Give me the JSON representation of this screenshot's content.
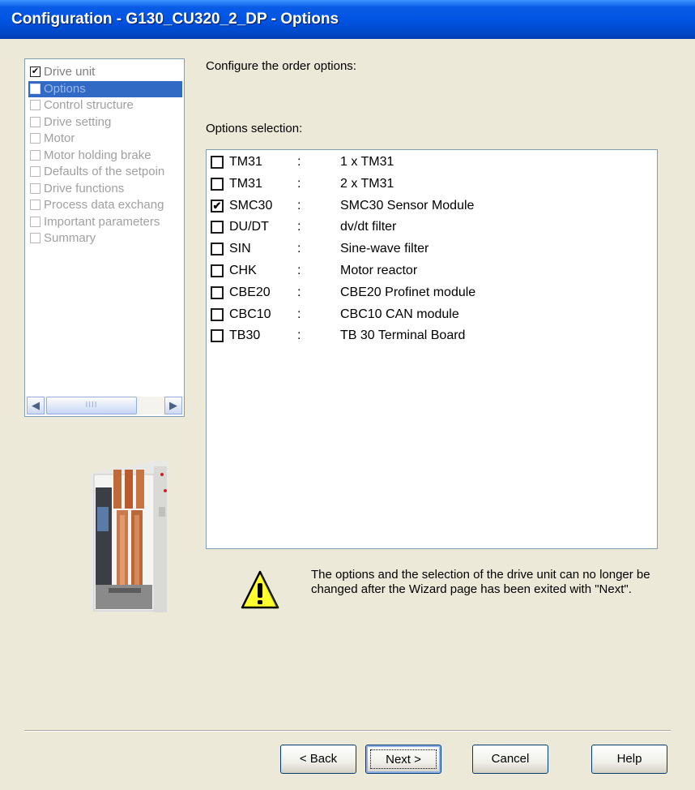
{
  "window": {
    "title": "Configuration - G130_CU320_2_DP - Options"
  },
  "nav": {
    "items": [
      {
        "label": "Drive unit",
        "checked": true,
        "selected": false
      },
      {
        "label": "Options",
        "checked": false,
        "selected": true
      },
      {
        "label": "Control structure",
        "checked": false,
        "selected": false
      },
      {
        "label": "Drive setting",
        "checked": false,
        "selected": false
      },
      {
        "label": "Motor",
        "checked": false,
        "selected": false
      },
      {
        "label": "Motor holding brake",
        "checked": false,
        "selected": false
      },
      {
        "label": "Defaults of the setpoin",
        "checked": false,
        "selected": false
      },
      {
        "label": "Drive functions",
        "checked": false,
        "selected": false
      },
      {
        "label": "Process data exchang",
        "checked": false,
        "selected": false
      },
      {
        "label": "Important parameters",
        "checked": false,
        "selected": false
      },
      {
        "label": "Summary",
        "checked": false,
        "selected": false
      }
    ],
    "scroll_left_icon": "arrow-left-icon",
    "scroll_right_icon": "arrow-right-icon",
    "thumb_grip": "IIII"
  },
  "main": {
    "intro": "Configure the order options:",
    "options_heading": "Options selection:",
    "separator": ":",
    "options": [
      {
        "code": "TM31",
        "desc": "1 x TM31",
        "checked": false
      },
      {
        "code": "TM31",
        "desc": "2 x TM31",
        "checked": false
      },
      {
        "code": "SMC30",
        "desc": "SMC30 Sensor Module",
        "checked": true
      },
      {
        "code": "DU/DT",
        "desc": "dv/dt filter",
        "checked": false
      },
      {
        "code": "SIN",
        "desc": "Sine-wave filter",
        "checked": false
      },
      {
        "code": "CHK",
        "desc": "Motor reactor",
        "checked": false
      },
      {
        "code": "CBE20",
        "desc": "CBE20 Profinet module",
        "checked": false
      },
      {
        "code": "CBC10",
        "desc": "CBC10 CAN module",
        "checked": false
      },
      {
        "code": "TB30",
        "desc": "TB 30 Terminal Board",
        "checked": false
      }
    ],
    "warning": {
      "icon": "warning-icon",
      "text": "The options and the selection of the drive unit can no longer be changed after the Wizard page has been exited with \"Next\"."
    }
  },
  "buttons": {
    "back": "< Back",
    "next": "Next >",
    "cancel": "Cancel",
    "help": "Help"
  },
  "colors": {
    "title_bar": "#0054e3",
    "selection": "#316ac5",
    "dialog_bg": "#ece9d8"
  }
}
